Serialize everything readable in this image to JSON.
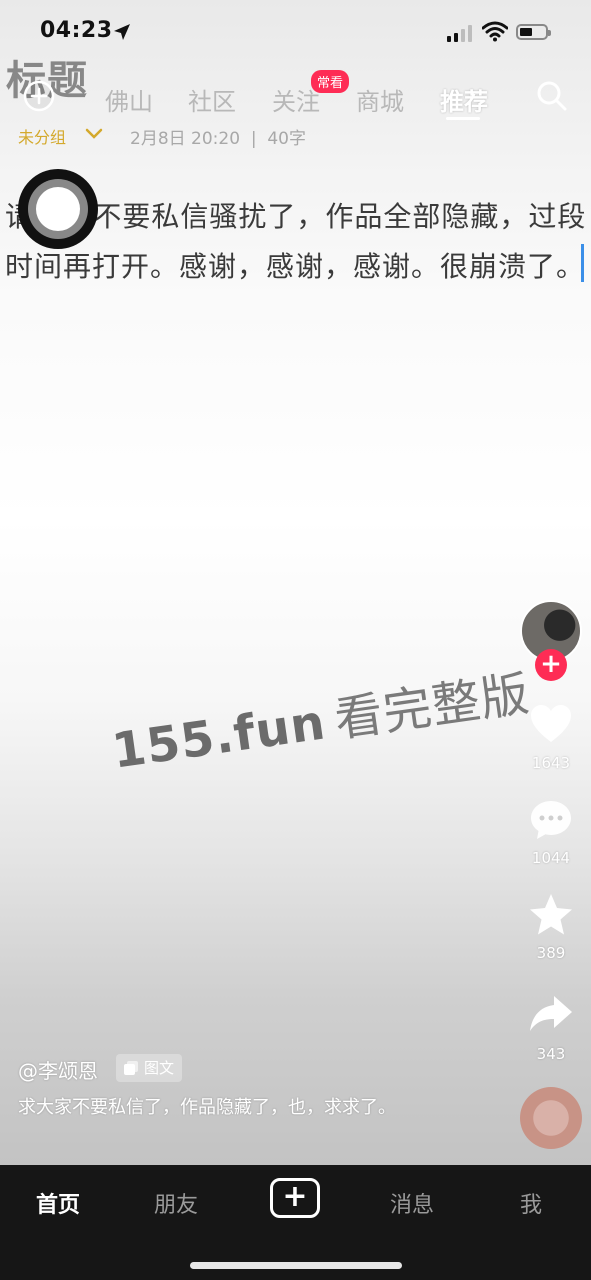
{
  "status_bar": {
    "time": "04:23"
  },
  "overlay_title": "标题",
  "top_nav": {
    "tabs": [
      {
        "label": "佛山"
      },
      {
        "label": "社区"
      },
      {
        "label": "关注"
      },
      {
        "label": "商城"
      },
      {
        "label": "推荐"
      }
    ],
    "active_tab": "推荐",
    "follow_badge": "常看"
  },
  "meta": {
    "group": "未分组",
    "info": "2月8日 20:20  |  40字"
  },
  "body": {
    "line1": "请      不要私信骚扰了，作品全部隐藏，过段",
    "line2": "时间再打开。感谢，感谢，感谢。很崩溃了。"
  },
  "watermark": {
    "site": "155.fun",
    "suffix": "看完整版"
  },
  "rail": {
    "likes": "1643",
    "comments": "1044",
    "favorites": "389",
    "shares": "343"
  },
  "post": {
    "author": "@李颂恩",
    "tag": "图文",
    "caption": "求大家不要私信了，作品隐藏了，也，求求了。"
  },
  "bottom_nav": {
    "home": "首页",
    "friends": "朋友",
    "messages": "消息",
    "me": "我"
  },
  "colors": {
    "accent": "#fe2c55",
    "group_gold": "#d4a92c",
    "caret_blue": "#3b8fe8"
  }
}
